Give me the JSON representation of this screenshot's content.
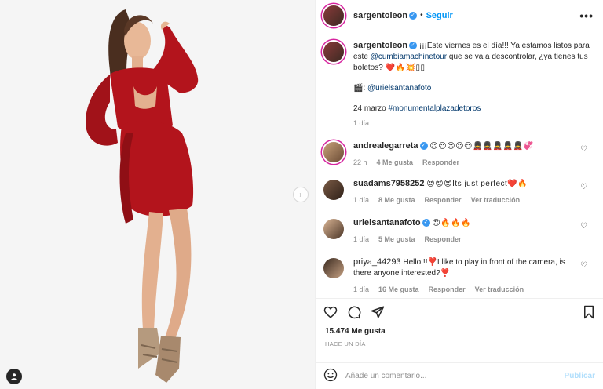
{
  "post": {
    "author": "sargentoleon",
    "follow_label": "Seguir",
    "separator": "•",
    "more_label": "•••"
  },
  "caption": {
    "username": "sargentoleon",
    "text_a": "¡¡¡Este viernes es el día!!! Ya estamos listos para este ",
    "mention": "@cumbiamachinetour",
    "text_b": " que se va a descontrolar, ¿ya tienes tus boletos? ",
    "emojis": "❤️🔥💥▯▯",
    "credit_icon": "🎬",
    "credit_prefix": ": ",
    "credit_mention": "@urielsantanafoto",
    "date_text": "24 marzo ",
    "hashtag": "#monumentalplazadetoros",
    "time": "1 día"
  },
  "comments": [
    {
      "username": "andrealegarreta",
      "verified": true,
      "text": "😍😍😍😍😍💂💂💂💂💂💞",
      "time": "22 h",
      "likes": "4 Me gusta",
      "reply": "Responder",
      "translate": ""
    },
    {
      "username": "suadams7958252",
      "verified": false,
      "text": "😍😍😍Its just perfect❤️🔥",
      "time": "1 día",
      "likes": "8 Me gusta",
      "reply": "Responder",
      "translate": "Ver traducción"
    },
    {
      "username": "urielsantanafoto",
      "verified": true,
      "text": "😍🔥🔥🔥",
      "time": "1 día",
      "likes": "5 Me gusta",
      "reply": "Responder",
      "translate": ""
    },
    {
      "username": "priya_44293",
      "verified": false,
      "text": "Hello!!!❣️I like to play in front of the camera, is there anyone interested?❣️.",
      "time": "1 día",
      "likes": "16 Me gusta",
      "reply": "Responder",
      "translate": "Ver traducción"
    }
  ],
  "actions": {
    "likes": "15.474 Me gusta",
    "timeago": "HACE UN DÍA"
  },
  "add_comment": {
    "placeholder": "Añade un comentario...",
    "publish_label": "Publicar"
  },
  "colors": {
    "accent": "#0095f6",
    "verified": "#3897f0",
    "dress": "#b3141c",
    "link": "#00376b"
  },
  "icons": [
    "heart-icon",
    "comment-icon",
    "share-icon",
    "bookmark-icon",
    "emoji-icon",
    "verified-icon",
    "more-options-icon",
    "next-arrow-icon",
    "user-tag-icon"
  ]
}
